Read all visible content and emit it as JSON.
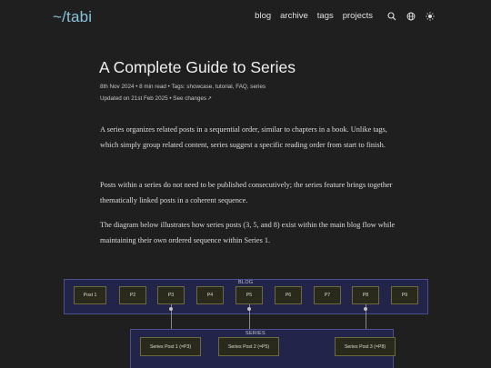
{
  "header": {
    "logo": "~/tabi",
    "nav": [
      "blog",
      "archive",
      "tags",
      "projects"
    ],
    "icons": [
      "search-icon",
      "globe-icon",
      "theme-toggle-icon"
    ]
  },
  "article": {
    "title": "A Complete Guide to Series",
    "meta_line1": "8th Nov 2024 • 8 min read • Tags: showcase, tutorial, FAQ, series",
    "meta_line2_prefix": "Updated on 21st Feb 2025 • ",
    "meta_line2_link": "See changes",
    "paragraphs": [
      "A series organizes related posts in a sequential order, similar to chapters in a book. Unlike tags, which simply group related content, series suggest a specific reading order from start to finish.",
      "Posts within a series do not need to be published consecutively; the series feature brings together thematically linked posts in a coherent sequence.",
      "The diagram below illustrates how series posts (3, 5, and 8) exist within the main blog flow while maintaining their own ordered sequence within Series 1."
    ]
  },
  "diagram": {
    "blog_label": "BLOG",
    "series_label": "SERIES",
    "blog_posts": [
      "Post 1",
      "P2",
      "P3",
      "P4",
      "P5",
      "P6",
      "P7",
      "P8",
      "P9"
    ],
    "series_posts": [
      "Series Post 1 (=P3)",
      "Series Post 2 (=P5)",
      "Series Post 3 (=P8)"
    ]
  },
  "colors": {
    "background": "#1f1f1f",
    "accent": "#87c3da",
    "diagram_box": "#22244a",
    "node_fill": "#2a2a1c"
  }
}
